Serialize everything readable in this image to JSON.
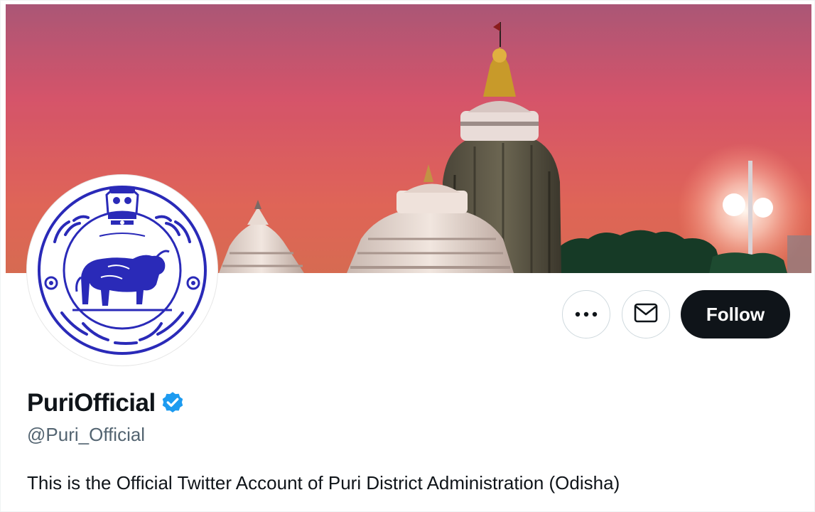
{
  "profile": {
    "display_name": "PuriOfficial",
    "handle": "@Puri_Official",
    "bio": "This is the Official Twitter Account of Puri District Administration (Odisha)",
    "verified": true
  },
  "actions": {
    "more_icon": "ellipsis-icon",
    "message_icon": "envelope-icon",
    "follow_label": "Follow"
  },
  "colors": {
    "follow_bg": "#0f1419",
    "verified_blue": "#1d9bf0",
    "handle_gray": "#536471",
    "seal_blue": "#2a2ab8"
  }
}
